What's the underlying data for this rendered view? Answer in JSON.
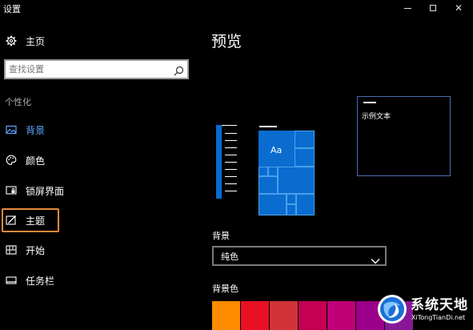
{
  "window": {
    "title": "设置",
    "minimize": "—",
    "maximize": "□",
    "close": "✕"
  },
  "sidebar": {
    "home": {
      "label": "主页",
      "icon": "gear-icon"
    },
    "search": {
      "placeholder": "查找设置",
      "icon": "search-icon"
    },
    "section_heading": "个性化",
    "items": [
      {
        "label": "背景",
        "icon": "picture-icon",
        "active": true
      },
      {
        "label": "颜色",
        "icon": "palette-icon",
        "active": false
      },
      {
        "label": "锁屏界面",
        "icon": "lock-screen-icon",
        "active": false
      },
      {
        "label": "主题",
        "icon": "theme-icon",
        "active": false,
        "highlighted": true
      },
      {
        "label": "开始",
        "icon": "start-icon",
        "active": false
      },
      {
        "label": "任务栏",
        "icon": "taskbar-icon",
        "active": false
      }
    ]
  },
  "main": {
    "title": "预览",
    "preview": {
      "tile_label": "Aa",
      "window_sample_text": "示例文本"
    },
    "background": {
      "label": "背景",
      "selected": "纯色"
    },
    "background_color": {
      "label": "背景色",
      "swatches": [
        "#ff8c00",
        "#e81123",
        "#d13438",
        "#c30052",
        "#bf0077",
        "#9a0089",
        "#881798"
      ]
    }
  },
  "colors": {
    "accent": "#0a6ccf",
    "active_nav": "#5ea7ff",
    "highlight_border": "#e88b3a"
  },
  "watermark": {
    "name": "系统天地",
    "url": "XiTongTianDi.net"
  }
}
